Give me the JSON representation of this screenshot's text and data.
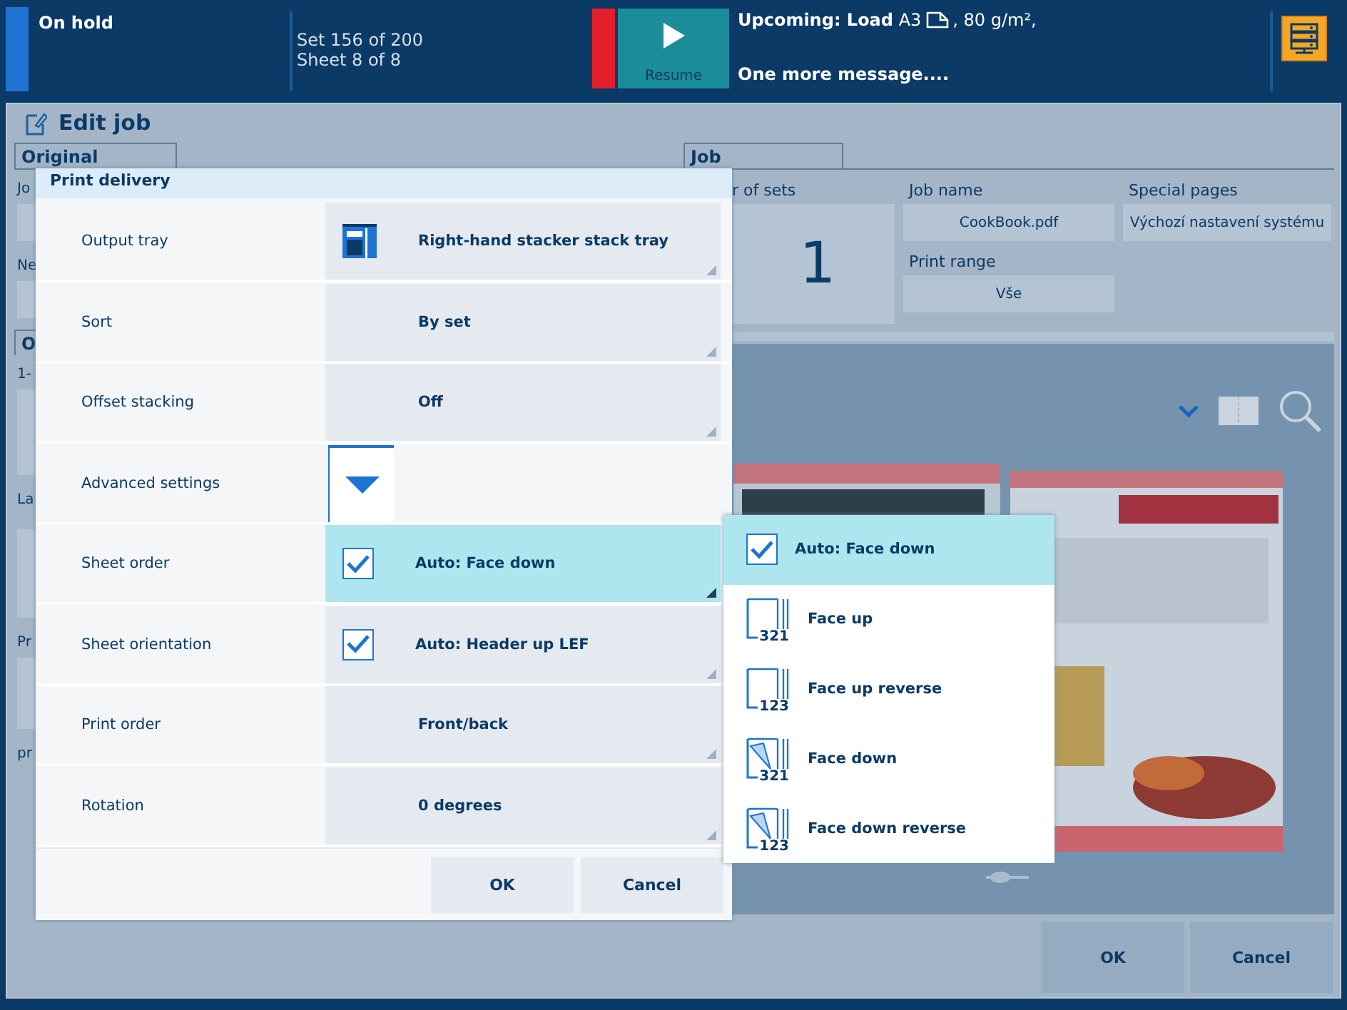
{
  "status_bar": {
    "state": "On hold",
    "set_progress": "Set 156 of 200",
    "sheet_progress": "Sheet 8 of 8",
    "alert": true,
    "resume_button": "Resume",
    "message": "**Upcoming: Load** A3",
    "message_suffix": ", 80 g/m²,",
    "message_2": "One more message...."
  },
  "window": {
    "title": "Edit job"
  },
  "original_panel": {
    "tab": "Original",
    "labels": [
      "Jo",
      "Ne"
    ]
  },
  "output_panel": {
    "tab": "O",
    "labels": [
      "1-",
      "La",
      "Pr",
      "pr"
    ]
  },
  "job_panel": {
    "tab": "Job",
    "fields": [
      {
        "label": "r of sets",
        "value": "1",
        "kind": "big"
      },
      {
        "label": "Job name",
        "value": "CookBook.pdf",
        "kind": "field"
      },
      {
        "label": "Special pages",
        "value": "Výchozí nastavení systému",
        "kind": "field"
      },
      {
        "label": "Print range",
        "value": "Vše",
        "kind": "field"
      }
    ]
  },
  "buttons": [
    "OK",
    "Cancel"
  ],
  "dialog": {
    "title": "Print delivery",
    "rows": [
      {
        "label": "Output tray",
        "value": "Right-hand stacker stack tray",
        "kind": "tray",
        "selected": false
      },
      {
        "label": "Sort",
        "value": "By set",
        "kind": "value",
        "selected": false
      },
      {
        "label": "Offset stacking",
        "value": "Off",
        "kind": "value",
        "selected": false
      },
      {
        "label": "Advanced settings",
        "kind": "expander",
        "selected": false
      },
      {
        "label": "Sheet order",
        "value": "Auto: Face down",
        "kind": "check",
        "checked": true,
        "selected": true
      },
      {
        "label": "Sheet orientation",
        "value": "Auto: Header up LEF",
        "kind": "check",
        "checked": true,
        "selected": false
      },
      {
        "label": "Print order",
        "value": "Front/back",
        "kind": "value",
        "selected": false
      },
      {
        "label": "Rotation",
        "value": "0 degrees",
        "kind": "value",
        "selected": false
      }
    ],
    "buttons": [
      "OK",
      "Cancel"
    ]
  },
  "dropdown": {
    "options": [
      {
        "label": "Auto: Face down",
        "kind": "auto",
        "checked": true,
        "selected": true
      },
      {
        "label": "Face up",
        "kind": "face_up",
        "digits": "321",
        "selected": false
      },
      {
        "label": "Face up reverse",
        "kind": "face_up",
        "digits": "123",
        "selected": false
      },
      {
        "label": "Face down",
        "kind": "face_down",
        "digits": "321",
        "selected": false
      },
      {
        "label": "Face down reverse",
        "kind": "face_down",
        "digits": "123",
        "selected": false
      }
    ]
  }
}
